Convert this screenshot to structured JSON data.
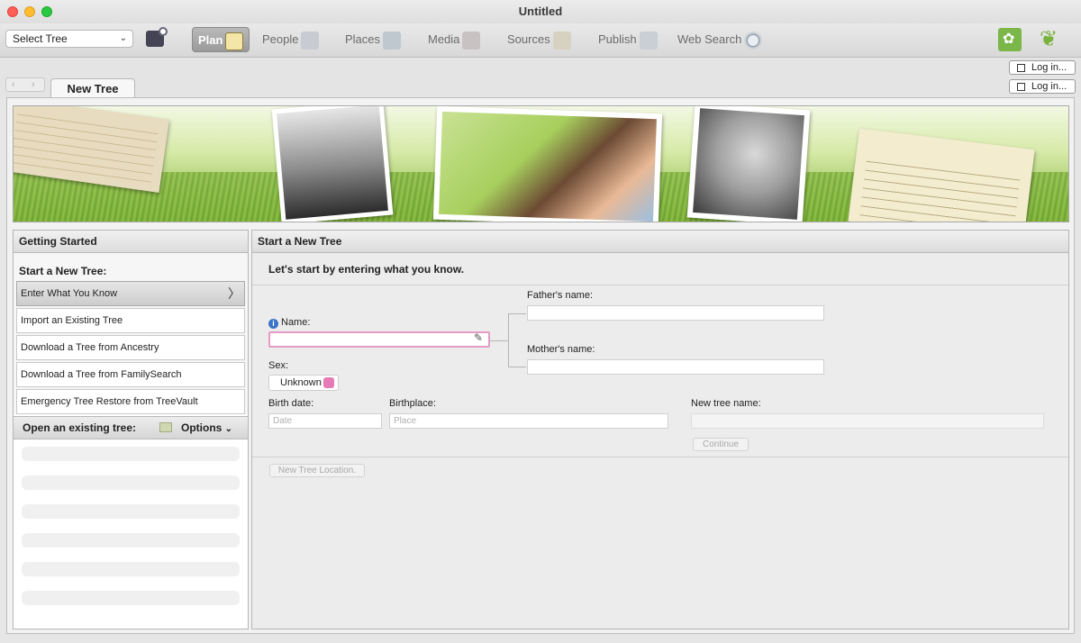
{
  "window": {
    "title": "Untitled"
  },
  "toolbar": {
    "select_tree": "Select Tree",
    "tabs": [
      {
        "label": "Plan",
        "icon": "notepad-pencil-icon",
        "active": true
      },
      {
        "label": "People",
        "icon": "people-icon",
        "active": false
      },
      {
        "label": "Places",
        "icon": "map-icon",
        "active": false
      },
      {
        "label": "Media",
        "icon": "media-icon",
        "active": false
      },
      {
        "label": "Sources",
        "icon": "scroll-icon",
        "active": false
      },
      {
        "label": "Publish",
        "icon": "publish-chart-icon",
        "active": false
      },
      {
        "label": "Web Search",
        "icon": "magnifier-globe-icon",
        "active": false
      }
    ]
  },
  "login": {
    "ancestry_label": "Log in...",
    "familysearch_label": "Log in..."
  },
  "doc_tab": {
    "label": "New Tree"
  },
  "getting_started": {
    "title": "Getting Started",
    "start_label": "Start a New Tree:",
    "items": [
      {
        "label": "Enter What You Know"
      },
      {
        "label": "Import an Existing Tree"
      },
      {
        "label": "Download a Tree from Ancestry"
      },
      {
        "label": "Download a Tree from FamilySearch"
      },
      {
        "label": "Emergency Tree Restore from TreeVault"
      }
    ],
    "open_label": "Open an existing tree:",
    "options_label": "Options"
  },
  "start_form": {
    "title": "Start a New Tree",
    "intro": "Let's start by entering what you know.",
    "name_label": "Name:",
    "father_label": "Father's name:",
    "mother_label": "Mother's name:",
    "sex_label": "Sex:",
    "sex_value": "Unknown",
    "birth_date_label": "Birth date:",
    "birth_date_placeholder": "Date",
    "birthplace_label": "Birthplace:",
    "birthplace_placeholder": "Place",
    "tree_name_label": "New tree name:",
    "continue_label": "Continue",
    "location_label": "New Tree Location."
  }
}
